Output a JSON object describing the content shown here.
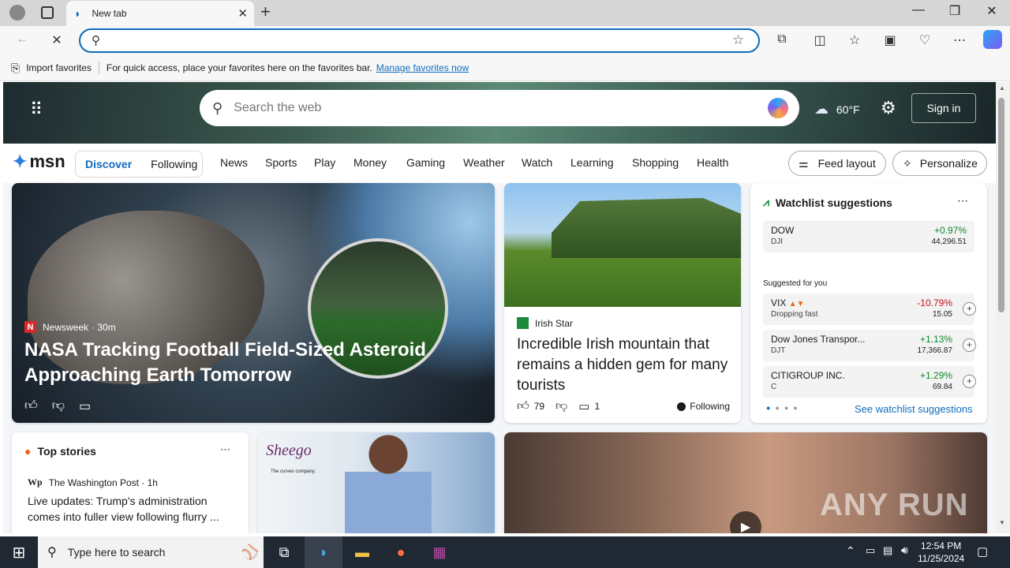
{
  "browser": {
    "tab_title": "New tab",
    "tab_close": "✕",
    "new_tab": "+",
    "window_controls": [
      "—",
      "❐",
      "✕"
    ],
    "favorites_bar": {
      "import_label": "Import favorites",
      "hint": "For quick access, place your favorites here on the favorites bar.",
      "manage_link": "Manage favorites now"
    }
  },
  "msn": {
    "search_placeholder": "Search the web",
    "weather": {
      "temp": "60°F"
    },
    "signin": "Sign in",
    "logo": "msn",
    "pill": {
      "discover": "Discover",
      "following": "Following"
    },
    "nav": [
      "News",
      "Sports",
      "Play",
      "Money",
      "Gaming",
      "Weather",
      "Watch",
      "Learning",
      "Shopping",
      "Health"
    ],
    "feed_layout": "Feed layout",
    "personalize": "Personalize"
  },
  "main_story": {
    "source": "Newsweek",
    "time": "· 30m",
    "title": "NASA Tracking Football Field-Sized Asteroid Approaching Earth Tomorrow"
  },
  "irish_story": {
    "source": "Irish Star",
    "title": "Incredible Irish mountain that remains a hidden gem for many tourists",
    "likes": "79",
    "comments": "1",
    "following": "Following"
  },
  "watchlist": {
    "title": "Watchlist suggestions",
    "main": {
      "name": "DOW",
      "symbol": "DJI",
      "change": "+0.97%",
      "price": "44,296.51"
    },
    "suggested_label": "Suggested for you",
    "items": [
      {
        "name": "VIX",
        "symbol": "Dropping fast",
        "change": "-10.79%",
        "price": "15.05"
      },
      {
        "name": "Dow Jones Transpor...",
        "symbol": "DJT",
        "change": "+1.13%",
        "price": "17,366.87"
      },
      {
        "name": "CITIGROUP INC.",
        "symbol": "C",
        "change": "+1.29%",
        "price": "69.84"
      }
    ],
    "see_link": "See watchlist suggestions"
  },
  "top_stories": {
    "title": "Top stories",
    "source": "The Washington Post · 1h",
    "headline": "Live updates: Trump's administration comes into fuller view following flurry ..."
  },
  "ad": {
    "brand": "Sheego",
    "tagline": "The curves company."
  },
  "watermark": "ANY RUN",
  "taskbar": {
    "search_placeholder": "Type here to search",
    "time": "12:54 PM",
    "date": "11/25/2024"
  }
}
